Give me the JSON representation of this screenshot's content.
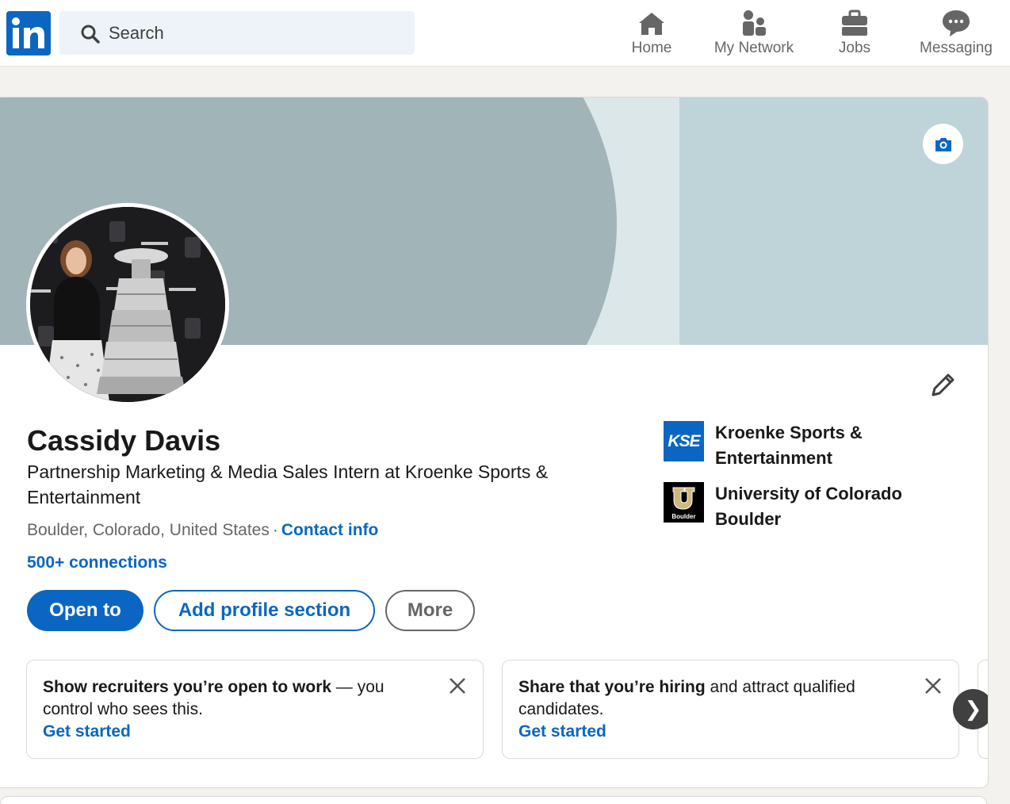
{
  "nav": {
    "search_placeholder": "Search",
    "items": [
      {
        "label": "Home",
        "icon": "home-icon"
      },
      {
        "label": "My Network",
        "icon": "people-icon"
      },
      {
        "label": "Jobs",
        "icon": "briefcase-icon"
      },
      {
        "label": "Messaging",
        "icon": "chat-icon"
      }
    ]
  },
  "profile": {
    "name": "Cassidy Davis",
    "headline": "Partnership Marketing & Media Sales Intern at Kroenke Sports & Entertainment",
    "location": "Boulder, Colorado, United States",
    "contact_info": "Contact info",
    "connections": "500+ connections",
    "buttons": {
      "open_to": "Open to",
      "add_section": "Add profile section",
      "more": "More"
    },
    "orgs": [
      {
        "name": "Kroenke Sports & Entertainment",
        "logo_text": "KSE"
      },
      {
        "name": "University of Colorado Boulder",
        "logo_text": "Boulder"
      }
    ]
  },
  "promos": [
    {
      "bold": "Show recruiters you’re open to work",
      "rest": " — you control who sees this.",
      "cta": "Get started"
    },
    {
      "bold": "Share that you’re hiring",
      "rest": " and attract qualified candidates.",
      "cta": "Get started"
    }
  ],
  "colors": {
    "brand": "#0a66c2",
    "banner": "#bfd4d9",
    "banner_arc": "#a1b4b8",
    "page_bg": "#f4f2ee"
  }
}
